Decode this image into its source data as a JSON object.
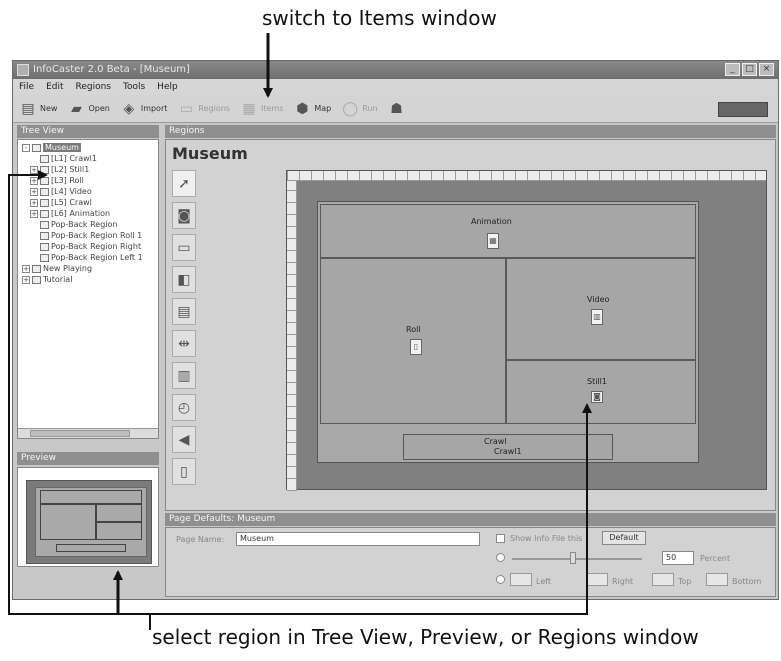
{
  "callouts": {
    "top": "switch to Items window",
    "bottom": "select region in Tree View, Preview, or Regions window"
  },
  "window": {
    "title": "InfoCaster 2.0 Beta - [Museum]",
    "controls": {
      "minimize": "_",
      "maximize": "□",
      "close": "×"
    }
  },
  "menu": [
    "File",
    "Edit",
    "Regions",
    "Tools",
    "Help"
  ],
  "toolbar": {
    "new": "New",
    "open": "Open",
    "import": "Import",
    "regions": "Regions",
    "items": "Items",
    "map": "Map",
    "run": "Run",
    "new_icon": "new-document-icon",
    "open_icon": "open-folder-icon",
    "import_icon": "import-icon",
    "regions_icon": "regions-icon",
    "items_icon": "items-icon",
    "map_icon": "map-icon",
    "run_icon": "run-icon",
    "users_icon": "users-icon"
  },
  "tree_view": {
    "header": "Tree View",
    "items": [
      "Museum",
      "[L1] Crawl1",
      "[L2] Still1",
      "[L3] Roll",
      "[L4] Video",
      "[L5] Crawl",
      "[L6] Animation",
      "Pop-Back Region",
      "Pop-Back Region Roll 1",
      "Pop-Back Region Right",
      "Pop-Back Region Left 1",
      "New Playing",
      "Tutorial"
    ]
  },
  "preview": {
    "header": "Preview"
  },
  "regions_window": {
    "header": "Regions",
    "page_title": "Museum",
    "tools": [
      "select-arrow-icon",
      "image-tool-icon",
      "movie-tool-icon",
      "text-tool-icon",
      "slide-tool-icon",
      "crawl-tool-icon",
      "video-tool-icon",
      "clock-tool-icon",
      "audio-tool-icon",
      "item-tool-icon"
    ],
    "regions": {
      "animation": "Animation",
      "video": "Video",
      "roll": "Roll",
      "still": "Still1",
      "crawl": "Crawl",
      "crawl_sub": "Crawl1"
    }
  },
  "page_defaults": {
    "header": "Page Defaults: Museum",
    "page_name_label": "Page Name:",
    "page_name_value": "Museum",
    "show_info_label": "Show Info File this",
    "default_button": "Default",
    "speed_value": "50",
    "speed_label": "Percent",
    "left_label": "Left",
    "right_label": "Right",
    "top_label": "Top",
    "bottom_label": "Bottom"
  }
}
